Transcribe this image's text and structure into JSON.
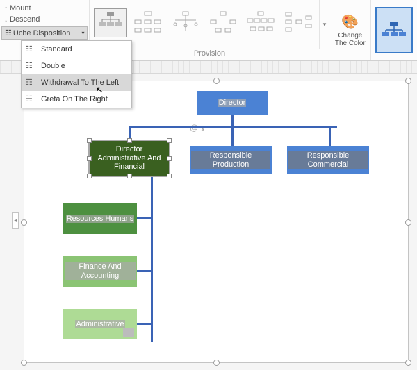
{
  "ribbon": {
    "mount": "Mount",
    "descend": "Descend",
    "disposition_label": "Uche Disposition",
    "section_label": "Provision",
    "change_color": "Change The Color"
  },
  "dropdown": {
    "items": [
      {
        "label": "Standard"
      },
      {
        "label": "Double"
      },
      {
        "label": "Withdrawal To The Left"
      },
      {
        "label": "Greta On The Right"
      }
    ],
    "hovered_index": 2
  },
  "chart_data": {
    "type": "tree",
    "nodes": {
      "director": "Director",
      "daf": "Director Administrative And Financial",
      "prod": "Responsible Production",
      "comm": "Responsible Commercial",
      "hr": "Resources Humans",
      "fin": "Finance And Accounting",
      "adm": "Administrative"
    },
    "edges": [
      [
        "director",
        "daf"
      ],
      [
        "director",
        "prod"
      ],
      [
        "director",
        "comm"
      ],
      [
        "daf",
        "hr"
      ],
      [
        "daf",
        "fin"
      ],
      [
        "daf",
        "adm"
      ]
    ],
    "selected": "daf",
    "colors": {
      "director": "#4b82d4",
      "daf": "#3a6020",
      "prod": "#4b82d4",
      "comm": "#4b82d4",
      "hr": "#4d9040",
      "fin": "#8bc474",
      "adm": "#aedb95"
    }
  }
}
